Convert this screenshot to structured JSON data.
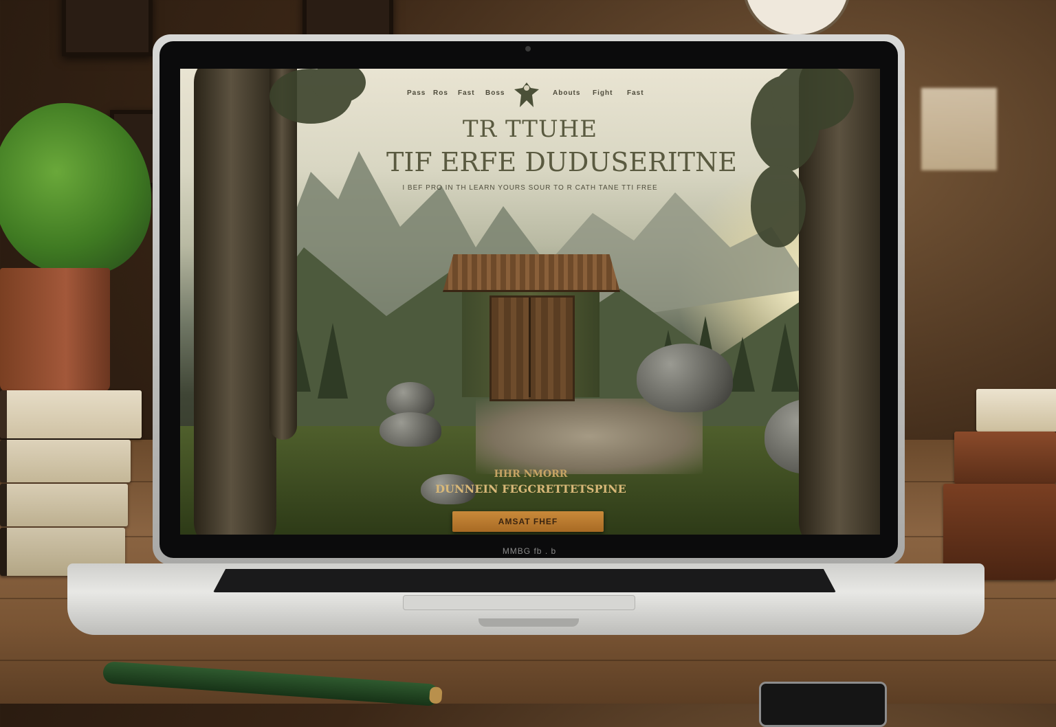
{
  "website": {
    "nav": {
      "left_items": [
        "Pass",
        "Ros",
        "Fast",
        "Boss"
      ],
      "right_items": [
        "Abouts",
        "Fight",
        "Fast"
      ]
    },
    "logo_icon": "eagle-icon",
    "hero": {
      "title_line1": "TR TTUHE",
      "title_line2": "TIF ERFE DUDUSERITNE",
      "subtitle": "I BEF PRO IN TH LEARN YOURS SOUR TO R CATH TANE TTI FREE"
    },
    "promo": {
      "line1": "HHR NMORR",
      "line2": "DUNNEIN FEGCRETTETSPINE"
    },
    "cta_label": "AMSAT FHEF"
  },
  "laptop": {
    "brand_label": "MMBG  fb . b"
  },
  "colors": {
    "cta_fill": "#b87a30",
    "title_text": "#5a5a40",
    "promo_text": "#d0ad6e"
  }
}
